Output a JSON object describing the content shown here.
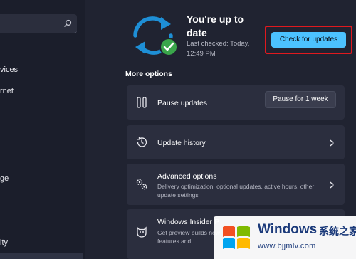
{
  "sidebar": {
    "items": [
      {
        "label": "vices"
      },
      {
        "label": "rnet"
      },
      {
        "label": "ge"
      },
      {
        "label": "ity"
      }
    ]
  },
  "status": {
    "title": "You're up to date",
    "subtitle": "Last checked: Today, 12:49 PM",
    "check_button": "Check for updates"
  },
  "more_options": {
    "label": "More options",
    "pause": {
      "title": "Pause updates",
      "button": "Pause for 1 week"
    },
    "history": {
      "title": "Update history"
    },
    "advanced": {
      "title": "Advanced options",
      "description": "Delivery optimization, optional updates, active hours, other update settings"
    },
    "insider": {
      "title": "Windows Insider P",
      "description": "Get preview builds new features and"
    }
  },
  "watermark": {
    "brand": "Windows",
    "brand_cn": "系统之家",
    "url": "www.bjjmlv.com"
  },
  "colors": {
    "background": "#202331",
    "card": "#2b2e3e",
    "accent": "#4cc2ff",
    "sync_icon": "#1e8fd6",
    "check_badge": "#3aa64b",
    "highlight_border": "#e0191e"
  },
  "icons": {
    "search": "search-icon",
    "sync": "sync-icon",
    "pause": "pause-icon",
    "history": "history-icon",
    "advanced": "gears-icon",
    "insider": "insider-cat-icon",
    "chevron": "chevron-right-icon"
  }
}
